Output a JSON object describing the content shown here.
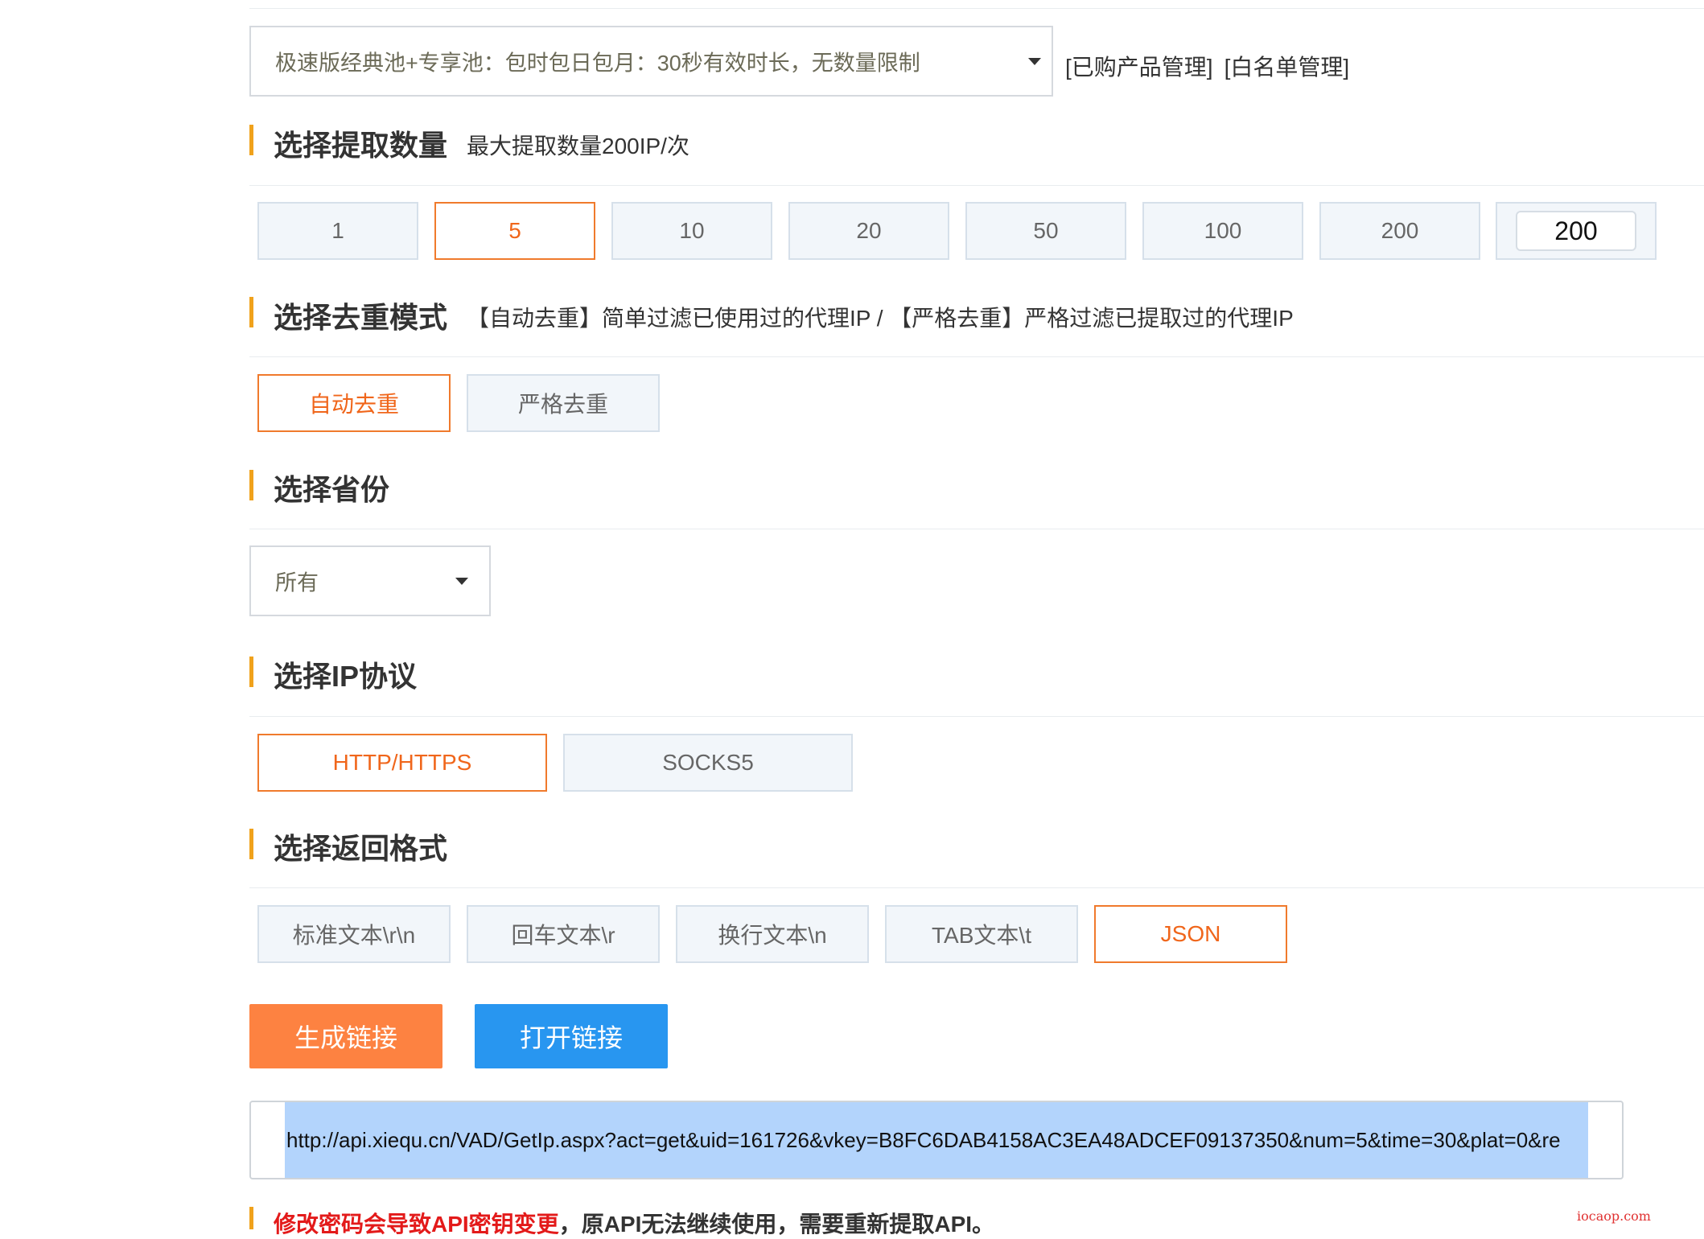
{
  "product_select": {
    "value": "极速版经典池+专享池：包时包日包月：30秒有效时长，无数量限制"
  },
  "links": {
    "purchased": "[已购产品管理]",
    "whitelist": "[白名单管理]"
  },
  "quantity": {
    "title": "选择提取数量",
    "desc": "最大提取数量200IP/次",
    "options": [
      "1",
      "5",
      "10",
      "20",
      "50",
      "100",
      "200"
    ],
    "selected": "5",
    "custom_value": "200"
  },
  "dedup": {
    "title": "选择去重模式",
    "desc": "【自动去重】简单过滤已使用过的代理IP  /  【严格去重】严格过滤已提取过的代理IP",
    "options": [
      "自动去重",
      "严格去重"
    ],
    "selected": "自动去重"
  },
  "province": {
    "title": "选择省份",
    "value": "所有"
  },
  "protocol": {
    "title": "选择IP协议",
    "options": [
      "HTTP/HTTPS",
      "SOCKS5"
    ],
    "selected": "HTTP/HTTPS"
  },
  "format": {
    "title": "选择返回格式",
    "options": [
      "标准文本\\r\\n",
      "回车文本\\r",
      "换行文本\\n",
      "TAB文本\\t",
      "JSON"
    ],
    "selected": "JSON"
  },
  "actions": {
    "generate": "生成链接",
    "open": "打开链接"
  },
  "colors": {
    "generate_bg": "#fd8241",
    "open_bg": "#2896f0",
    "accent_bar": "#f0a21c",
    "active": "#f0661b"
  },
  "generated_link": "http://api.xiequ.cn/VAD/GetIp.aspx?act=get&uid=161726&vkey=B8FC6DAB4158AC3EA48ADCEF09137350&num=5&time=30&plat=0&re",
  "warning": {
    "red": "修改密码会导致API密钥变更",
    "rest": "，原API无法继续使用，需要重新提取API。"
  },
  "watermark": "iocaop.com"
}
